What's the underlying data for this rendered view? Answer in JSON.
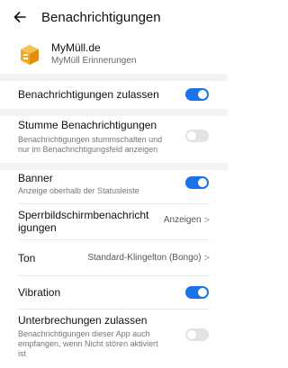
{
  "header": {
    "title": "Benachrichtigungen",
    "back_icon": "arrow-left-icon"
  },
  "app": {
    "name": "MyMüll.de",
    "subtitle": "MyMüll Erinnerungen",
    "icon": "box-logo-icon"
  },
  "colors": {
    "accent": "#1a73e8",
    "toggle_off": "#e3e3e3",
    "band": "#f1f3f5"
  },
  "settings": {
    "allow": {
      "label": "Benachrichtigungen zulassen",
      "on": true
    },
    "silent": {
      "label": "Stumme Benachrichtigungen",
      "desc_line1": "Benachrichtigungen stummschalten und",
      "desc_line2": "nur im Benachrichtigungsfeld anzeigen",
      "on": false
    },
    "banner": {
      "label": "Banner",
      "desc": "Anzeige oberhalb der Statusleiste",
      "on": true
    },
    "lockscreen": {
      "label_line1": "Sperrbildschirmbenachricht",
      "label_line2": "igungen",
      "value": "Anzeigen"
    },
    "tone": {
      "label": "Ton",
      "value": "Standard-Klingelton (Bongo)"
    },
    "vibration": {
      "label": "Vibration",
      "on": true
    },
    "interruptions": {
      "label": "Unterbrechungen zulassen",
      "desc_line1": "Benachrichtigungen dieser App auch",
      "desc_line2": "empfangen, wenn Nicht stören aktiviert",
      "desc_line3": "ist",
      "on": false
    }
  }
}
